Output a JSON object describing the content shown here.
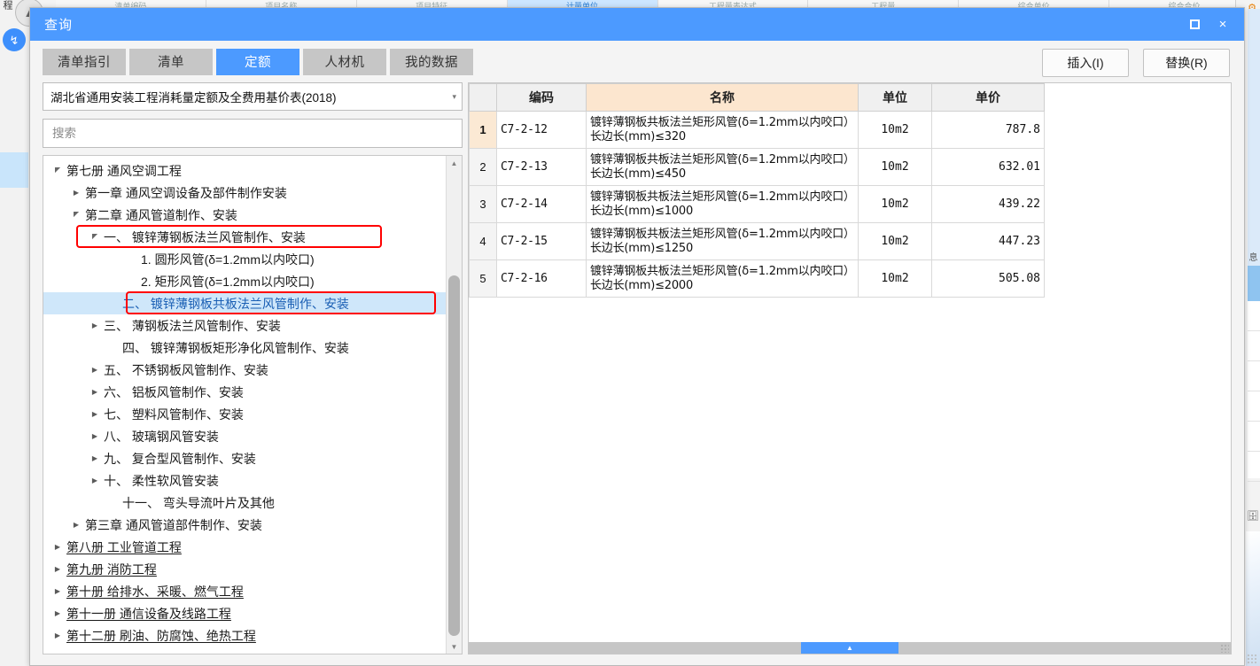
{
  "background": {
    "left_label": "程",
    "collapse_icon": "chevron-up-icon",
    "download_icon": "download-icon",
    "gear_icon": "gear-icon",
    "right_tab_label": "息",
    "top_cells": [
      "清单编码",
      "项目名称",
      "项目特征",
      "计量单位",
      "工程量表达式",
      "工程量",
      "综合单价",
      "综合合价"
    ],
    "top_selected_index": 3
  },
  "dialog": {
    "title": "查询",
    "window_controls": {
      "maximize": "maximize-icon",
      "close": "×"
    }
  },
  "toolbar": {
    "tabs": [
      {
        "label": "清单指引",
        "active": false
      },
      {
        "label": "清单",
        "active": false
      },
      {
        "label": "定额",
        "active": true
      },
      {
        "label": "人材机",
        "active": false
      },
      {
        "label": "我的数据",
        "active": false
      }
    ],
    "actions": [
      {
        "label": "插入(I)",
        "name": "insert-button"
      },
      {
        "label": "替换(R)",
        "name": "replace-button"
      }
    ]
  },
  "left_pane": {
    "library_select": {
      "value": "湖北省通用安装工程消耗量定额及全费用基价表(2018)",
      "caret": "▾"
    },
    "search": {
      "value": "",
      "placeholder": "搜索"
    },
    "tree": [
      {
        "label": "第七册 通风空调工程",
        "indent": 0,
        "toggle": "expanded",
        "style": "normal"
      },
      {
        "label": "第一章 通风空调设备及部件制作安装",
        "indent": 1,
        "toggle": "collapsed",
        "style": "normal"
      },
      {
        "label": "第二章 通风管道制作、安装",
        "indent": 1,
        "toggle": "expanded",
        "style": "normal"
      },
      {
        "label": "一、 镀锌薄钢板法兰风管制作、安装",
        "indent": 2,
        "toggle": "expanded",
        "style": "normal",
        "highlight_box": true
      },
      {
        "label": "1. 圆形风管(δ=1.2mm以内咬口)",
        "indent": 4,
        "toggle": "none",
        "style": "normal"
      },
      {
        "label": "2. 矩形风管(δ=1.2mm以内咬口)",
        "indent": 4,
        "toggle": "none",
        "style": "normal"
      },
      {
        "label": "二、 镀锌薄钢板共板法兰风管制作、安装",
        "indent": 3,
        "toggle": "none",
        "style": "link",
        "selected": true,
        "highlight_box": true
      },
      {
        "label": "三、 薄钢板法兰风管制作、安装",
        "indent": 2,
        "toggle": "collapsed",
        "style": "normal"
      },
      {
        "label": "四、 镀锌薄钢板矩形净化风管制作、安装",
        "indent": 3,
        "toggle": "none",
        "style": "normal"
      },
      {
        "label": "五、 不锈钢板风管制作、安装",
        "indent": 2,
        "toggle": "collapsed",
        "style": "normal"
      },
      {
        "label": "六、 铝板风管制作、安装",
        "indent": 2,
        "toggle": "collapsed",
        "style": "normal"
      },
      {
        "label": "七、 塑料风管制作、安装",
        "indent": 2,
        "toggle": "collapsed",
        "style": "normal"
      },
      {
        "label": "八、 玻璃钢风管安装",
        "indent": 2,
        "toggle": "collapsed",
        "style": "normal"
      },
      {
        "label": "九、 复合型风管制作、安装",
        "indent": 2,
        "toggle": "collapsed",
        "style": "normal"
      },
      {
        "label": "十、 柔性软风管安装",
        "indent": 2,
        "toggle": "collapsed",
        "style": "normal"
      },
      {
        "label": "十一、 弯头导流叶片及其他",
        "indent": 3,
        "toggle": "none",
        "style": "normal"
      },
      {
        "label": "第三章 通风管道部件制作、安装",
        "indent": 1,
        "toggle": "collapsed",
        "style": "normal"
      },
      {
        "label": "第八册 工业管道工程",
        "indent": 0,
        "toggle": "collapsed",
        "style": "underline"
      },
      {
        "label": "第九册 消防工程",
        "indent": 0,
        "toggle": "collapsed",
        "style": "underline"
      },
      {
        "label": "第十册 给排水、采暖、燃气工程",
        "indent": 0,
        "toggle": "collapsed",
        "style": "underline"
      },
      {
        "label": "第十一册 通信设备及线路工程",
        "indent": 0,
        "toggle": "collapsed",
        "style": "underline"
      },
      {
        "label": "第十二册 刷油、防腐蚀、绝热工程",
        "indent": 0,
        "toggle": "collapsed",
        "style": "underline"
      }
    ],
    "scrollbar": {
      "up_arrow": "▲",
      "down_arrow": "▼"
    }
  },
  "right_pane": {
    "columns": [
      "",
      "编码",
      "名称",
      "单位",
      "单价"
    ],
    "rows": [
      {
        "index": "1",
        "code": "C7-2-12",
        "name": "镀锌薄钢板共板法兰矩形风管(δ=1.2mm以内咬口）长边长(mm)≤320",
        "unit": "10m2",
        "price": "787.8",
        "active": true
      },
      {
        "index": "2",
        "code": "C7-2-13",
        "name": "镀锌薄钢板共板法兰矩形风管(δ=1.2mm以内咬口）长边长(mm)≤450",
        "unit": "10m2",
        "price": "632.01",
        "active": false
      },
      {
        "index": "3",
        "code": "C7-2-14",
        "name": "镀锌薄钢板共板法兰矩形风管(δ=1.2mm以内咬口）长边长(mm)≤1000",
        "unit": "10m2",
        "price": "439.22",
        "active": false
      },
      {
        "index": "4",
        "code": "C7-2-15",
        "name": "镀锌薄钢板共板法兰矩形风管(δ=1.2mm以内咬口）长边长(mm)≤1250",
        "unit": "10m2",
        "price": "447.23",
        "active": false
      },
      {
        "index": "5",
        "code": "C7-2-16",
        "name": "镀锌薄钢板共板法兰矩形风管(δ=1.2mm以内咬口）长边长(mm)≤2000",
        "unit": "10m2",
        "price": "505.08",
        "active": false
      }
    ],
    "h_scroll_thumb_icon": "scroll-thumb-icon"
  },
  "colors": {
    "accent": "#4c9aff",
    "tab_inactive": "#c6c6c6",
    "name_header": "#fce6cf",
    "selection": "#cfe7fa",
    "highlight_box": "#ff0000",
    "link": "#1a5fb4"
  }
}
